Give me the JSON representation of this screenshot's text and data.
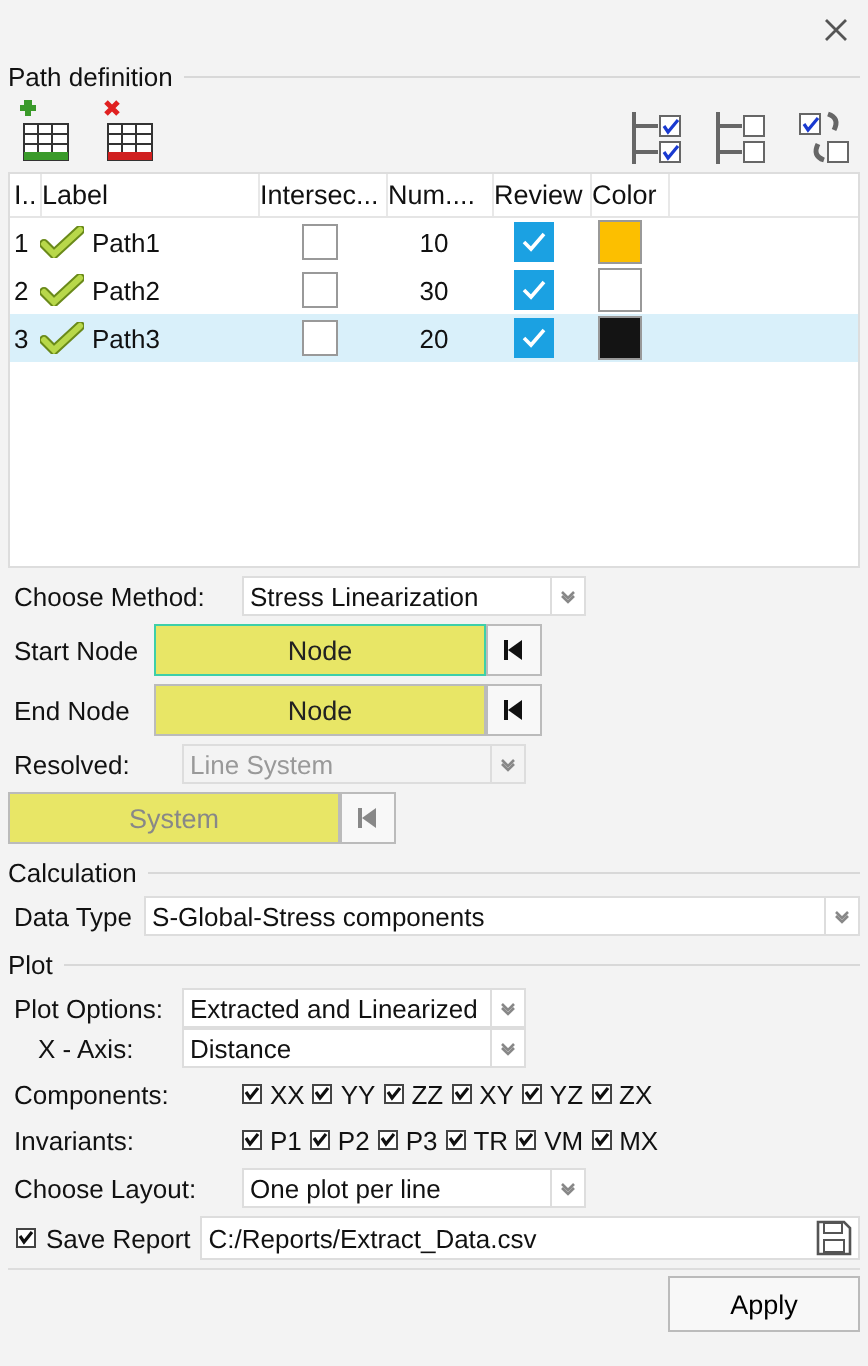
{
  "path_definition": {
    "title": "Path definition",
    "table": {
      "columns": [
        "I..",
        "Label",
        "Intersec...",
        "Num....",
        "Review",
        "Color"
      ],
      "rows": [
        {
          "index": "1",
          "label": "Path1",
          "intersect": false,
          "number": "10",
          "review": true,
          "color": "#fcbf00",
          "selected": false
        },
        {
          "index": "2",
          "label": "Path2",
          "intersect": false,
          "number": "30",
          "review": true,
          "color": "#ffffff",
          "selected": false
        },
        {
          "index": "3",
          "label": "Path3",
          "intersect": false,
          "number": "20",
          "review": true,
          "color": "#141414",
          "selected": true
        }
      ]
    }
  },
  "method": {
    "label": "Choose Method:",
    "value": "Stress Linearization"
  },
  "start_node": {
    "label": "Start Node",
    "button": "Node",
    "focused": true
  },
  "end_node": {
    "label": "End Node",
    "button": "Node",
    "focused": false
  },
  "resolved": {
    "label": "Resolved:",
    "value": "Line System",
    "disabled": true
  },
  "system": {
    "button": "System",
    "disabled": true
  },
  "calculation": {
    "title": "Calculation",
    "data_type": {
      "label": "Data Type",
      "value": "S-Global-Stress components"
    }
  },
  "plot": {
    "title": "Plot",
    "plot_options": {
      "label": "Plot Options:",
      "value": "Extracted and Linearized"
    },
    "x_axis": {
      "label": "X - Axis:",
      "value": "Distance"
    },
    "components": {
      "label": "Components:",
      "items": [
        {
          "label": "XX",
          "checked": true
        },
        {
          "label": "YY",
          "checked": true
        },
        {
          "label": "ZZ",
          "checked": true
        },
        {
          "label": "XY",
          "checked": true
        },
        {
          "label": "YZ",
          "checked": true
        },
        {
          "label": "ZX",
          "checked": true
        }
      ]
    },
    "invariants": {
      "label": "Invariants:",
      "items": [
        {
          "label": "P1",
          "checked": true
        },
        {
          "label": "P2",
          "checked": true
        },
        {
          "label": "P3",
          "checked": true
        },
        {
          "label": "TR",
          "checked": true
        },
        {
          "label": "VM",
          "checked": true
        },
        {
          "label": "MX",
          "checked": true
        }
      ]
    },
    "layout": {
      "label": "Choose Layout:",
      "value": "One plot per line"
    },
    "save_report": {
      "label": "Save Report",
      "checked": true,
      "value": "C:/Reports/Extract_Data.csv"
    }
  },
  "apply": "Apply"
}
